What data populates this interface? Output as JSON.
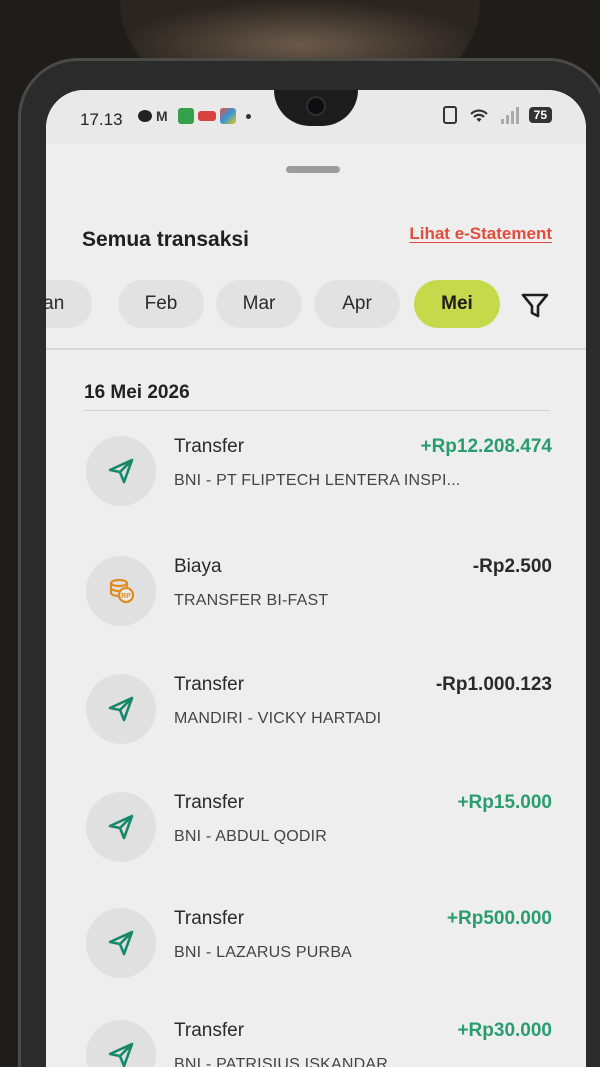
{
  "status_bar": {
    "time": "17.13",
    "notification_icons": [
      "chat-icon",
      "gmail-icon",
      "green-app-icon",
      "red-app-icon",
      "multicolor-app-icon",
      "dot-icon"
    ],
    "gmail_glyph": "M",
    "system_icons": [
      "vibrate-icon",
      "wifi-icon",
      "signal-icon",
      "battery-icon"
    ],
    "battery": "75"
  },
  "header": {
    "title": "Semua transaksi",
    "estatement_link": "Lihat e-Statement"
  },
  "months": [
    {
      "label": "Jan",
      "active": false
    },
    {
      "label": "Feb",
      "active": false
    },
    {
      "label": "Mar",
      "active": false
    },
    {
      "label": "Apr",
      "active": false
    },
    {
      "label": "Mei",
      "active": true
    }
  ],
  "date_group": "16 Mei 2026",
  "transactions": [
    {
      "type": "Transfer",
      "desc": "BNI - PT FLIPTECH LENTERA INSPI...",
      "amount": "+Rp12.208.474",
      "direction": "credit",
      "icon": "send-icon"
    },
    {
      "type": "Biaya",
      "desc": "TRANSFER BI-FAST",
      "amount": "-Rp2.500",
      "direction": "debit",
      "icon": "coin-stack-icon"
    },
    {
      "type": "Transfer",
      "desc": "MANDIRI - VICKY HARTADI",
      "amount": "-Rp1.000.123",
      "direction": "debit",
      "icon": "send-icon"
    },
    {
      "type": "Transfer",
      "desc": "BNI - ABDUL QODIR",
      "amount": "+Rp15.000",
      "direction": "credit",
      "icon": "send-icon"
    },
    {
      "type": "Transfer",
      "desc": "BNI - LAZARUS PURBA",
      "amount": "+Rp500.000",
      "direction": "credit",
      "icon": "send-icon"
    },
    {
      "type": "Transfer",
      "desc": "BNI - PATRISIUS ISKANDAR",
      "amount": "+Rp30.000",
      "direction": "credit",
      "icon": "send-icon"
    }
  ],
  "colors": {
    "accent_month": "#c6d94a",
    "credit": "#2a9d6f",
    "link": "#e04d3c",
    "icon_teal": "#17876a",
    "icon_orange": "#e08a22"
  }
}
